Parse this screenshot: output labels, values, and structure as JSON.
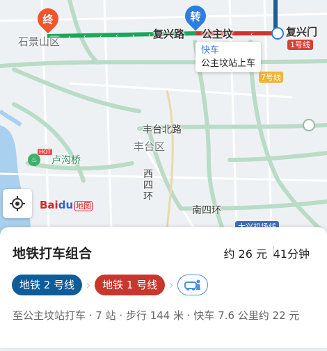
{
  "map": {
    "end_pin": "终",
    "transfer_pin": "转",
    "labels": {
      "shijingshan": "石景山区",
      "fuxinglu": "复兴路",
      "gongzhufen": "公主坟",
      "fuxingmen": "复兴门",
      "line1_badge": "1号线",
      "line7": "7号线",
      "fengtai_north": "丰台北路",
      "fengtai_district": "丰台区",
      "lugouqiao": "卢沟桥",
      "hot": "HOT",
      "west4": "西四环",
      "south4": "南四环",
      "daxing": "大兴机场线"
    },
    "callout": {
      "mode": "快车",
      "text": "公主坟站上车"
    },
    "locate_icon": "locate-icon",
    "logo": {
      "part1": "Bai",
      "part2": "du",
      "part3": "地图"
    },
    "colors": {
      "green_route": "#1aa65b",
      "red_route": "#d0352b",
      "blue_route": "#1e5e96",
      "pin_end": "#f2552c",
      "pin_transfer": "#2f7de1"
    }
  },
  "card": {
    "title": "地铁打车组合",
    "price": "约 26 元",
    "duration": "41分钟",
    "chips": [
      "地铁 2 号线",
      "地铁 1 号线"
    ],
    "taxi_icon": "taxi-person-icon",
    "detail": "至公主坟站打车 · 7 站 · 步行 144 米 · 快车 7.6 公里约 22 元"
  }
}
